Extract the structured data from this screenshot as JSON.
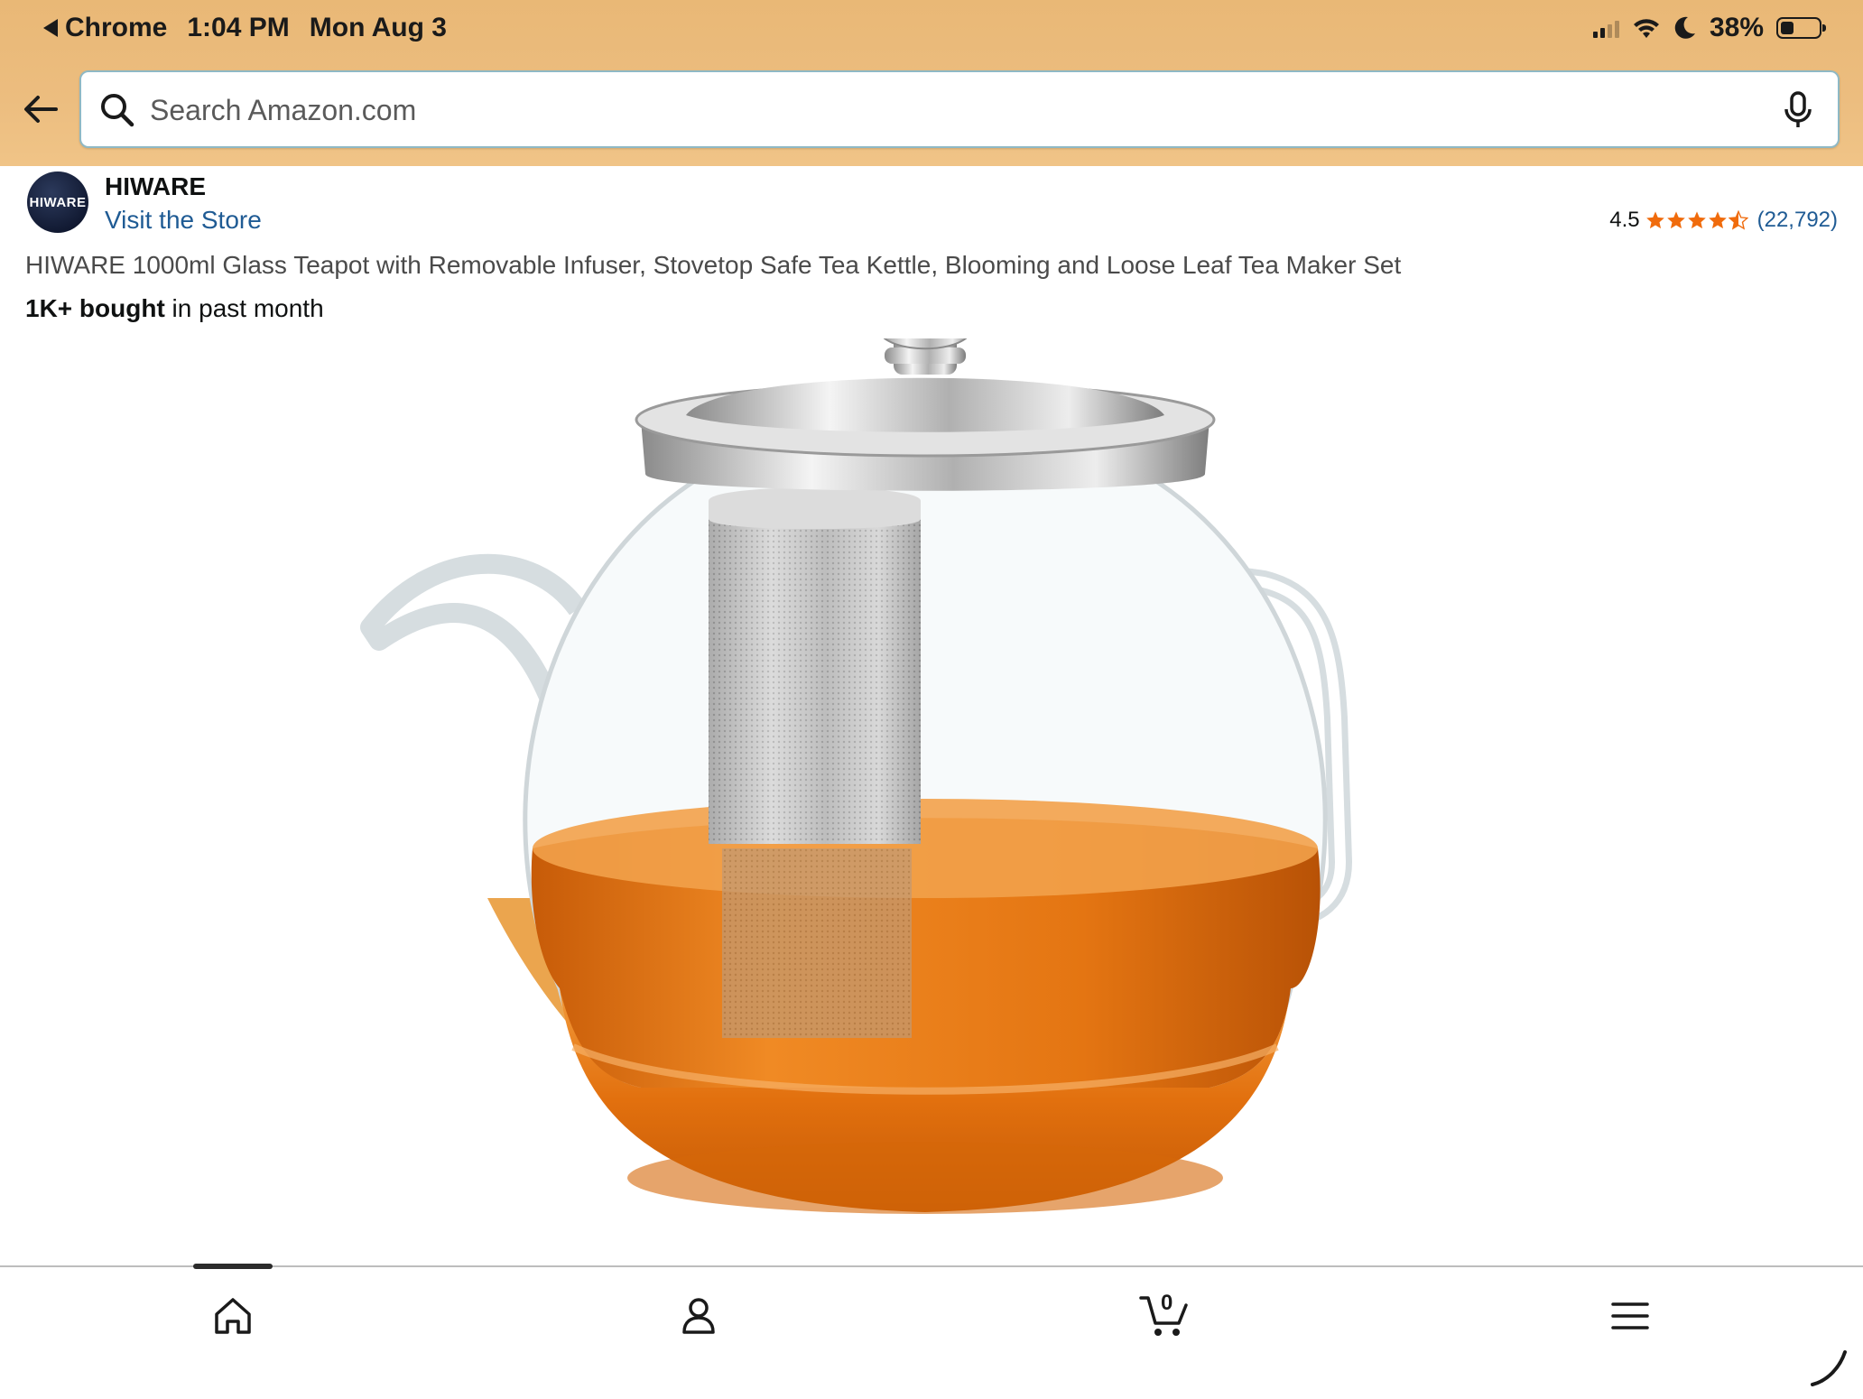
{
  "status_bar": {
    "app_back_label": "Chrome",
    "time": "1:04 PM",
    "date": "Mon Aug 3",
    "battery_percent": "38%",
    "battery_level": 0.38
  },
  "search": {
    "placeholder": "Search Amazon.com",
    "value": ""
  },
  "brand": {
    "logo_text": "HIWARE",
    "name": "HIWARE",
    "visit_store": "Visit the Store"
  },
  "rating": {
    "value": "4.5",
    "stars": 4.5,
    "review_count": "(22,792)"
  },
  "product": {
    "title": "HIWARE 1000ml Glass Teapot with Removable Infuser, Stovetop Safe Tea Kettle, Blooming and Loose Leaf Tea Maker Set",
    "bought_bold": "1K+ bought",
    "bought_rest": " in past month"
  },
  "bottom_nav": {
    "items": [
      "home-icon",
      "account-icon",
      "cart-icon",
      "menu-icon"
    ],
    "cart_count": "0",
    "active": "home"
  },
  "colors": {
    "header": "#ecbd7f",
    "link": "#1f5b94",
    "star": "#f06b0c",
    "tea": "#e87a12"
  }
}
